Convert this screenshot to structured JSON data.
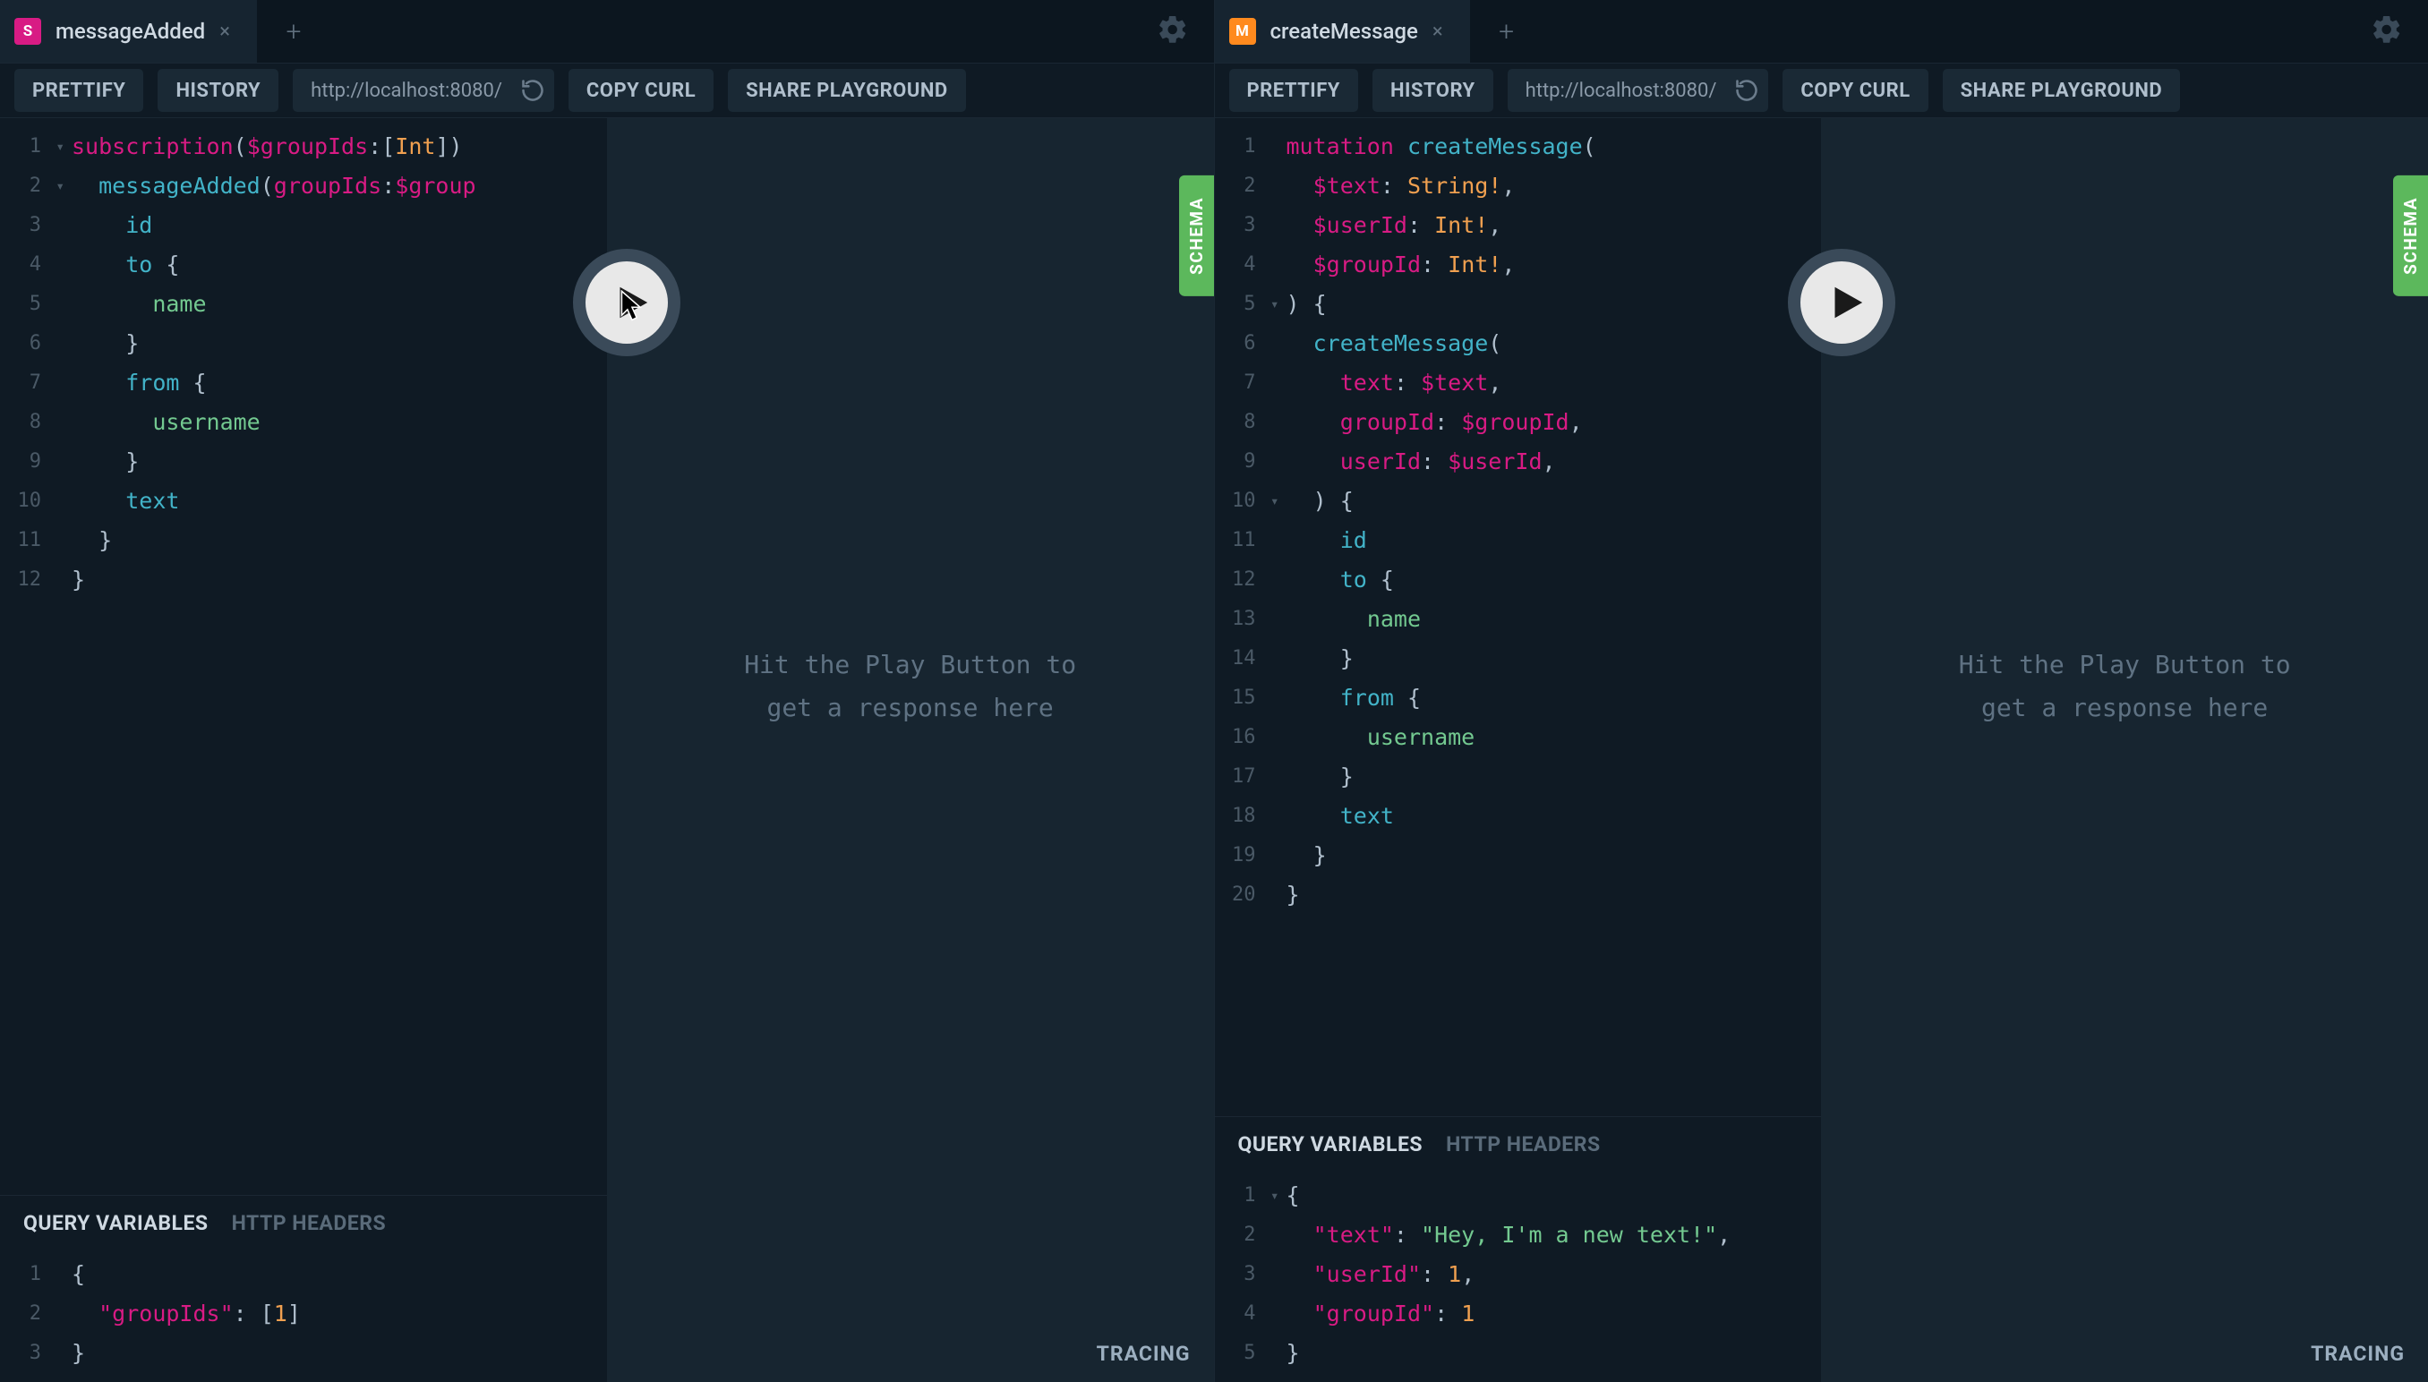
{
  "common": {
    "toolbar": {
      "prettify": "PRETTIFY",
      "history": "HISTORY",
      "copy_curl": "COPY CURL",
      "share": "SHARE PLAYGROUND"
    },
    "url": "http://localhost:8080/",
    "vars_tab_active": "QUERY VARIABLES",
    "vars_tab_inactive": "HTTP HEADERS",
    "result_placeholder": "Hit the Play Button to\nget a response here",
    "tracing": "TRACING",
    "schema": "SCHEMA",
    "tab_new": "+",
    "tab_close": "×"
  },
  "left": {
    "tab_badge": "S",
    "tab_title": "messageAdded",
    "query_lines": [
      [
        [
          "kw",
          "subscription"
        ],
        [
          "punc",
          "("
        ],
        [
          "var",
          "$groupIds"
        ],
        [
          "punc",
          ":"
        ],
        [
          "punc",
          "["
        ],
        [
          "type",
          "Int"
        ],
        [
          "punc",
          "]"
        ],
        [
          "punc",
          ")"
        ]
      ],
      [
        [
          "white",
          "  "
        ],
        [
          "fn",
          "messageAdded"
        ],
        [
          "punc",
          "("
        ],
        [
          "arg",
          "groupIds"
        ],
        [
          "punc",
          ":"
        ],
        [
          "var",
          "$group"
        ]
      ],
      [
        [
          "white",
          "    "
        ],
        [
          "field",
          "id"
        ]
      ],
      [
        [
          "white",
          "    "
        ],
        [
          "field",
          "to"
        ],
        [
          "white",
          " "
        ],
        [
          "punc",
          "{"
        ]
      ],
      [
        [
          "white",
          "      "
        ],
        [
          "name2",
          "name"
        ]
      ],
      [
        [
          "white",
          "    "
        ],
        [
          "punc",
          "}"
        ]
      ],
      [
        [
          "white",
          "    "
        ],
        [
          "field",
          "from"
        ],
        [
          "white",
          " "
        ],
        [
          "punc",
          "{"
        ]
      ],
      [
        [
          "white",
          "      "
        ],
        [
          "name2",
          "username"
        ]
      ],
      [
        [
          "white",
          "    "
        ],
        [
          "punc",
          "}"
        ]
      ],
      [
        [
          "white",
          "    "
        ],
        [
          "field",
          "text"
        ]
      ],
      [
        [
          "white",
          "  "
        ],
        [
          "punc",
          "}"
        ]
      ],
      [
        [
          "punc",
          "}"
        ]
      ]
    ],
    "fold_lines": [
      1,
      2
    ],
    "vars_lines": [
      [
        [
          "punc",
          "{"
        ]
      ],
      [
        [
          "white",
          "  "
        ],
        [
          "key",
          "\"groupIds\""
        ],
        [
          "punc",
          ": "
        ],
        [
          "punc",
          "["
        ],
        [
          "num",
          "1"
        ],
        [
          "punc",
          "]"
        ]
      ],
      [
        [
          "punc",
          "}"
        ]
      ]
    ],
    "vars_fold_lines": []
  },
  "right": {
    "tab_badge": "M",
    "tab_title": "createMessage",
    "query_lines": [
      [
        [
          "kw",
          "mutation"
        ],
        [
          "white",
          " "
        ],
        [
          "fn",
          "createMessage"
        ],
        [
          "punc",
          "("
        ]
      ],
      [
        [
          "white",
          "  "
        ],
        [
          "var",
          "$text"
        ],
        [
          "punc",
          ": "
        ],
        [
          "type",
          "String!"
        ],
        [
          "punc",
          ","
        ]
      ],
      [
        [
          "white",
          "  "
        ],
        [
          "var",
          "$userId"
        ],
        [
          "punc",
          ": "
        ],
        [
          "type",
          "Int!"
        ],
        [
          "punc",
          ","
        ]
      ],
      [
        [
          "white",
          "  "
        ],
        [
          "var",
          "$groupId"
        ],
        [
          "punc",
          ": "
        ],
        [
          "type",
          "Int!"
        ],
        [
          "punc",
          ","
        ]
      ],
      [
        [
          "punc",
          ")"
        ],
        [
          "white",
          " "
        ],
        [
          "punc",
          "{"
        ]
      ],
      [
        [
          "white",
          "  "
        ],
        [
          "fn",
          "createMessage"
        ],
        [
          "punc",
          "("
        ]
      ],
      [
        [
          "white",
          "    "
        ],
        [
          "arg",
          "text"
        ],
        [
          "punc",
          ": "
        ],
        [
          "var",
          "$text"
        ],
        [
          "punc",
          ","
        ]
      ],
      [
        [
          "white",
          "    "
        ],
        [
          "arg",
          "groupId"
        ],
        [
          "punc",
          ": "
        ],
        [
          "var",
          "$groupId"
        ],
        [
          "punc",
          ","
        ]
      ],
      [
        [
          "white",
          "    "
        ],
        [
          "arg",
          "userId"
        ],
        [
          "punc",
          ": "
        ],
        [
          "var",
          "$userId"
        ],
        [
          "punc",
          ","
        ]
      ],
      [
        [
          "white",
          "  "
        ],
        [
          "punc",
          ")"
        ],
        [
          "white",
          " "
        ],
        [
          "punc",
          "{"
        ]
      ],
      [
        [
          "white",
          "    "
        ],
        [
          "field",
          "id"
        ]
      ],
      [
        [
          "white",
          "    "
        ],
        [
          "field",
          "to"
        ],
        [
          "white",
          " "
        ],
        [
          "punc",
          "{"
        ]
      ],
      [
        [
          "white",
          "      "
        ],
        [
          "name2",
          "name"
        ]
      ],
      [
        [
          "white",
          "    "
        ],
        [
          "punc",
          "}"
        ]
      ],
      [
        [
          "white",
          "    "
        ],
        [
          "field",
          "from"
        ],
        [
          "white",
          " "
        ],
        [
          "punc",
          "{"
        ]
      ],
      [
        [
          "white",
          "      "
        ],
        [
          "name2",
          "username"
        ]
      ],
      [
        [
          "white",
          "    "
        ],
        [
          "punc",
          "}"
        ]
      ],
      [
        [
          "white",
          "    "
        ],
        [
          "field",
          "text"
        ]
      ],
      [
        [
          "white",
          "  "
        ],
        [
          "punc",
          "}"
        ]
      ],
      [
        [
          "punc",
          "}"
        ]
      ]
    ],
    "fold_lines": [
      5,
      10
    ],
    "vars_lines": [
      [
        [
          "punc",
          "{"
        ]
      ],
      [
        [
          "white",
          "  "
        ],
        [
          "key",
          "\"text\""
        ],
        [
          "punc",
          ": "
        ],
        [
          "str",
          "\"Hey, I'm a new text!\""
        ],
        [
          "punc",
          ","
        ]
      ],
      [
        [
          "white",
          "  "
        ],
        [
          "key",
          "\"userId\""
        ],
        [
          "punc",
          ": "
        ],
        [
          "num",
          "1"
        ],
        [
          "punc",
          ","
        ]
      ],
      [
        [
          "white",
          "  "
        ],
        [
          "key",
          "\"groupId\""
        ],
        [
          "punc",
          ": "
        ],
        [
          "num",
          "1"
        ]
      ],
      [
        [
          "punc",
          "}"
        ]
      ]
    ],
    "vars_fold_lines": [
      1
    ]
  }
}
